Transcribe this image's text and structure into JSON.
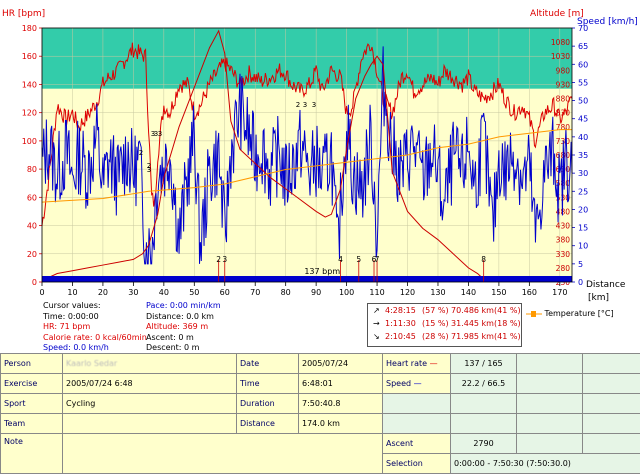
{
  "axes": {
    "hr_title": "HR [bpm]",
    "altitude_title": "Altitude [m]",
    "speed_title": "Speed [km/h]",
    "distance_title": "Distance",
    "distance_unit": "[km]"
  },
  "chart_data": {
    "type": "line",
    "x_ticks": [
      "0",
      "10",
      "20",
      "30",
      "40",
      "50",
      "60",
      "70",
      "80",
      "90",
      "100",
      "110",
      "120",
      "130",
      "140",
      "150",
      "160",
      "170"
    ],
    "hr_ticks": [
      "0",
      "20",
      "40",
      "60",
      "80",
      "100",
      "120",
      "140",
      "160",
      "180"
    ],
    "altitude_ticks": [
      "230",
      "280",
      "330",
      "380",
      "430",
      "480",
      "530",
      "580",
      "630",
      "680",
      "730",
      "780",
      "830",
      "880",
      "930",
      "980",
      "1030",
      "1080"
    ],
    "speed_ticks": [
      "0",
      "5",
      "10",
      "15",
      "20",
      "25",
      "30",
      "35",
      "40",
      "45",
      "50",
      "55",
      "60",
      "65",
      "70"
    ],
    "xlim": [
      0,
      174
    ],
    "hr_ylim": [
      0,
      180
    ],
    "speed_ylim": [
      0,
      70
    ],
    "altitude_ylim": [
      230,
      1130
    ],
    "hr_zone_upper": 180,
    "hr_zone_lower": 137,
    "hr_zone_color": "#33ccaa",
    "plot_bg": "#ffffcc",
    "series": [
      {
        "name": "Heart rate",
        "color": "#dd0000",
        "x": [
          0,
          2,
          5,
          8,
          10,
          12,
          15,
          18,
          20,
          22,
          25,
          28,
          30,
          32,
          34,
          36,
          37,
          38,
          40,
          42,
          45,
          48,
          50,
          52,
          55,
          58,
          60,
          62,
          65,
          68,
          70,
          72,
          75,
          78,
          80,
          82,
          85,
          88,
          90,
          92,
          95,
          98,
          100,
          102,
          105,
          108,
          110,
          112,
          115,
          118,
          120,
          122,
          125,
          128,
          130,
          132,
          135,
          138,
          140,
          142,
          145,
          148,
          150,
          152,
          155,
          158,
          160,
          162,
          165,
          168,
          170,
          172,
          174
        ],
        "y": [
          40,
          70,
          125,
          115,
          120,
          110,
          118,
          128,
          140,
          145,
          150,
          160,
          165,
          162,
          160,
          60,
          55,
          90,
          125,
          120,
          140,
          140,
          120,
          125,
          140,
          150,
          155,
          150,
          140,
          148,
          145,
          142,
          145,
          150,
          148,
          140,
          135,
          140,
          150,
          135,
          150,
          145,
          120,
          125,
          160,
          170,
          150,
          130,
          120,
          145,
          150,
          135,
          140,
          145,
          140,
          150,
          145,
          140,
          145,
          135,
          130,
          135,
          140,
          130,
          120,
          125,
          115,
          100,
          120,
          125,
          115,
          120,
          130
        ]
      },
      {
        "name": "Altitude",
        "color": "#cc0000",
        "x": [
          0,
          5,
          10,
          15,
          20,
          25,
          30,
          33,
          35,
          38,
          40,
          45,
          50,
          55,
          58,
          60,
          62,
          65,
          70,
          75,
          80,
          85,
          90,
          93,
          95,
          98,
          100,
          103,
          106,
          108,
          110,
          112,
          115,
          120,
          125,
          130,
          135,
          140,
          143,
          145,
          147,
          150,
          155,
          160,
          165,
          170,
          174
        ],
        "y": [
          235,
          260,
          270,
          280,
          290,
          300,
          310,
          330,
          360,
          470,
          600,
          780,
          920,
          1060,
          1120,
          1040,
          800,
          700,
          650,
          600,
          560,
          520,
          480,
          460,
          470,
          560,
          700,
          880,
          960,
          1000,
          1030,
          1000,
          620,
          480,
          420,
          380,
          330,
          280,
          260,
          240,
          235,
          232,
          232,
          232,
          232,
          232,
          232
        ]
      },
      {
        "name": "Speed",
        "color": "#0000cc",
        "x": [
          0,
          2,
          5,
          8,
          10,
          12,
          15,
          18,
          20,
          22,
          25,
          28,
          30,
          32,
          34,
          36,
          38,
          40,
          42,
          45,
          48,
          50,
          52,
          55,
          58,
          60,
          62,
          65,
          68,
          70,
          72,
          75,
          78,
          80,
          82,
          85,
          88,
          90,
          92,
          95,
          97,
          98,
          100,
          102,
          105,
          108,
          110,
          112,
          115,
          118,
          120,
          122,
          125,
          128,
          130,
          132,
          135,
          138,
          140,
          142,
          145,
          148,
          150,
          152,
          155,
          158,
          160,
          162,
          165,
          168,
          170,
          172,
          174
        ],
        "y": [
          32,
          38,
          30,
          36,
          28,
          35,
          30,
          40,
          26,
          34,
          28,
          36,
          30,
          34,
          10,
          8,
          30,
          32,
          36,
          12,
          30,
          40,
          10,
          30,
          35,
          12,
          36,
          48,
          40,
          34,
          38,
          30,
          36,
          28,
          32,
          38,
          30,
          34,
          28,
          36,
          8,
          20,
          44,
          30,
          25,
          40,
          12,
          55,
          36,
          30,
          34,
          38,
          28,
          36,
          30,
          20,
          34,
          30,
          38,
          26,
          40,
          14,
          34,
          30,
          36,
          28,
          32,
          12,
          30,
          36,
          24,
          34,
          30
        ]
      },
      {
        "name": "Temperature",
        "color": "#ff9900",
        "x": [
          0,
          20,
          35,
          50,
          60,
          70,
          80,
          90,
          100,
          110,
          120,
          130,
          140,
          150,
          160,
          170,
          174
        ],
        "y": [
          22,
          23,
          25,
          26,
          27,
          29,
          31,
          32,
          33,
          34,
          35,
          37,
          38,
          40,
          41,
          42,
          42
        ]
      }
    ],
    "lap_markers": [
      "2",
      "3",
      "4",
      "5",
      "6",
      "7",
      "8"
    ],
    "range_labels": [
      "2",
      "3",
      "2",
      "3",
      "3",
      "3",
      "2",
      "3",
      "3"
    ],
    "cursor_label": "137 bpm"
  },
  "cursor": {
    "header": "Cursor values:",
    "time": "Time: 0:00:00",
    "hr": "HR: 71 bpm",
    "calorie": "Calorie rate: 0 kcal/60min",
    "speed": "Speed: 0.0 km/h",
    "pace": "Pace: 0:00 min/km",
    "distance": "Distance: 0.0 km",
    "altitude": "Altitude: 369 m",
    "ascent": "Ascent: 0 m",
    "descent": "Descent: 0 m"
  },
  "stats": [
    {
      "arrow": "↗",
      "time": "4:28:15",
      "pct": "(57 %)",
      "dist": "70.486 km",
      "dpct": "(41 %)"
    },
    {
      "arrow": "→",
      "time": "1:11:30",
      "pct": "(15 %)",
      "dist": "31.445 km",
      "dpct": "(18 %)"
    },
    {
      "arrow": "↘",
      "time": "2:10:45",
      "pct": "(28 %)",
      "dist": "71.985 km",
      "dpct": "(41 %)"
    }
  ],
  "legend": {
    "temperature": "Temperature [°C]"
  },
  "info": {
    "person_label": "Person",
    "person_value": "Kaarlo Sedar",
    "exercise_label": "Exercise",
    "exercise_value": "2005/07/24 6:48",
    "sport_label": "Sport",
    "sport_value": "Cycling",
    "team_label": "Team",
    "note_label": "Note",
    "date_label": "Date",
    "date_value": "2005/07/24",
    "time_label": "Time",
    "time_value": "6:48:01",
    "duration_label": "Duration",
    "duration_value": "7:50:40.8",
    "distance_label": "Distance",
    "distance_value": "174.0 km",
    "hr_label": "Heart rate",
    "hr_value": "137 / 165",
    "speed_label": "Speed",
    "speed_value": "22.2 / 66.5",
    "ascent_label": "Ascent",
    "ascent_value": "2790",
    "selection_label": "Selection",
    "selection_value": "0:00:00 - 7:50:30 (7:50:30.0)",
    "hr_color": "#dd0000",
    "speed_color": "#0000cc"
  }
}
